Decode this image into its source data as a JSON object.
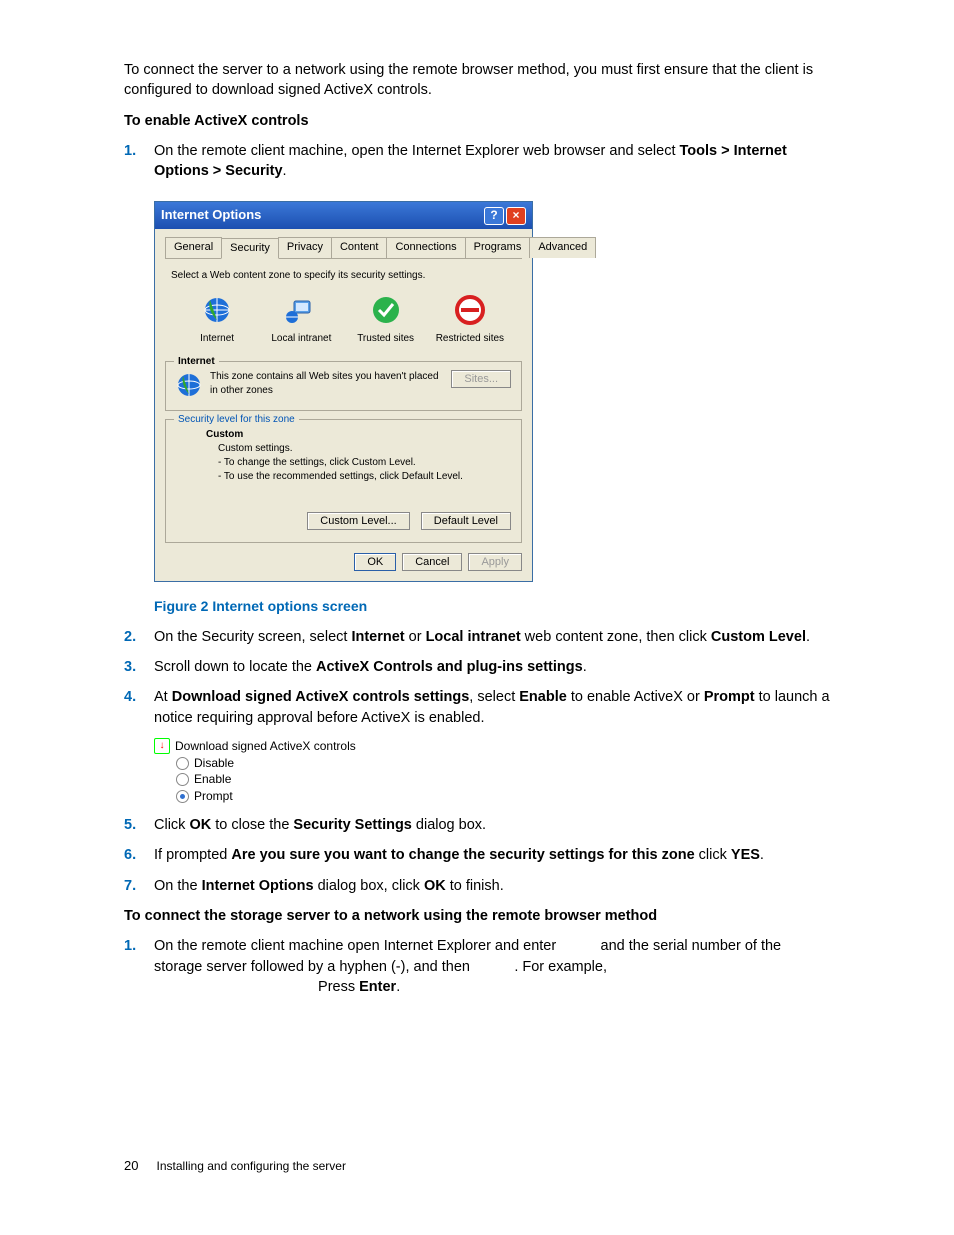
{
  "intro": "To connect the server to a network using the remote browser method, you must first ensure that the client is configured to download signed ActiveX controls.",
  "heading1": "To enable ActiveX controls",
  "step1": {
    "pre": "On the remote client machine, open the Internet Explorer web browser and select ",
    "bold1": "Tools > Internet Options > Security",
    "post": "."
  },
  "dialog": {
    "title": "Internet Options",
    "tabs": [
      "General",
      "Security",
      "Privacy",
      "Content",
      "Connections",
      "Programs",
      "Advanced"
    ],
    "select_text": "Select a Web content zone to specify its security settings.",
    "zones": [
      "Internet",
      "Local intranet",
      "Trusted sites",
      "Restricted sites"
    ],
    "fieldset1_legend": "Internet",
    "zone_desc": "This zone contains all Web sites you haven't placed in other zones",
    "sites_btn": "Sites...",
    "fieldset2_legend": "Security level for this zone",
    "custom": "Custom",
    "custom_line1": "Custom settings.",
    "custom_line2": "- To change the settings, click Custom Level.",
    "custom_line3": "- To use the recommended settings, click Default Level.",
    "custom_level_btn": "Custom Level...",
    "default_level_btn": "Default Level",
    "ok": "OK",
    "cancel": "Cancel",
    "apply": "Apply"
  },
  "figure_caption": "Figure 2 Internet options screen",
  "step2": {
    "pre": "On the Security screen, select ",
    "b1": "Internet",
    "mid1": " or ",
    "b2": "Local intranet",
    "mid2": " web content zone, then click ",
    "b3": "Custom Level",
    "post": "."
  },
  "step3": {
    "pre": "Scroll down to locate the ",
    "b1": "ActiveX Controls and plug-ins settings",
    "post": "."
  },
  "step4": {
    "pre": "At ",
    "b1": "Download signed ActiveX controls settings",
    "mid1": ", select ",
    "b2": "Enable",
    "mid2": " to enable ActiveX or ",
    "b3": "Prompt",
    "post": " to launch a notice requiring approval before ActiveX is enabled."
  },
  "activex": {
    "heading": "Download signed ActiveX controls",
    "opts": [
      "Disable",
      "Enable",
      "Prompt"
    ]
  },
  "step5": {
    "pre": "Click ",
    "b1": "OK",
    "mid1": " to close the ",
    "b2": "Security Settings",
    "post": " dialog box."
  },
  "step6": {
    "pre": "If prompted ",
    "b1": "Are you sure you want to change the security settings for this zone",
    "mid1": " click ",
    "b2": "YES",
    "post": "."
  },
  "step7": {
    "pre": "On the ",
    "b1": "Internet Options",
    "mid1": " dialog box, click ",
    "b2": "OK",
    "post": " to finish."
  },
  "heading2": "To connect the storage server to a network using the remote browser method",
  "connect_step1": {
    "pre": "On the remote client machine open Internet Explorer and enter ",
    "mid1": " and the serial number of the storage server followed by a hyphen (-), and then ",
    "mid2": ". For example, ",
    "enter_pre": "Press ",
    "enter": "Enter",
    "post2": "."
  },
  "footer": {
    "page": "20",
    "section": "Installing and configuring the server"
  }
}
